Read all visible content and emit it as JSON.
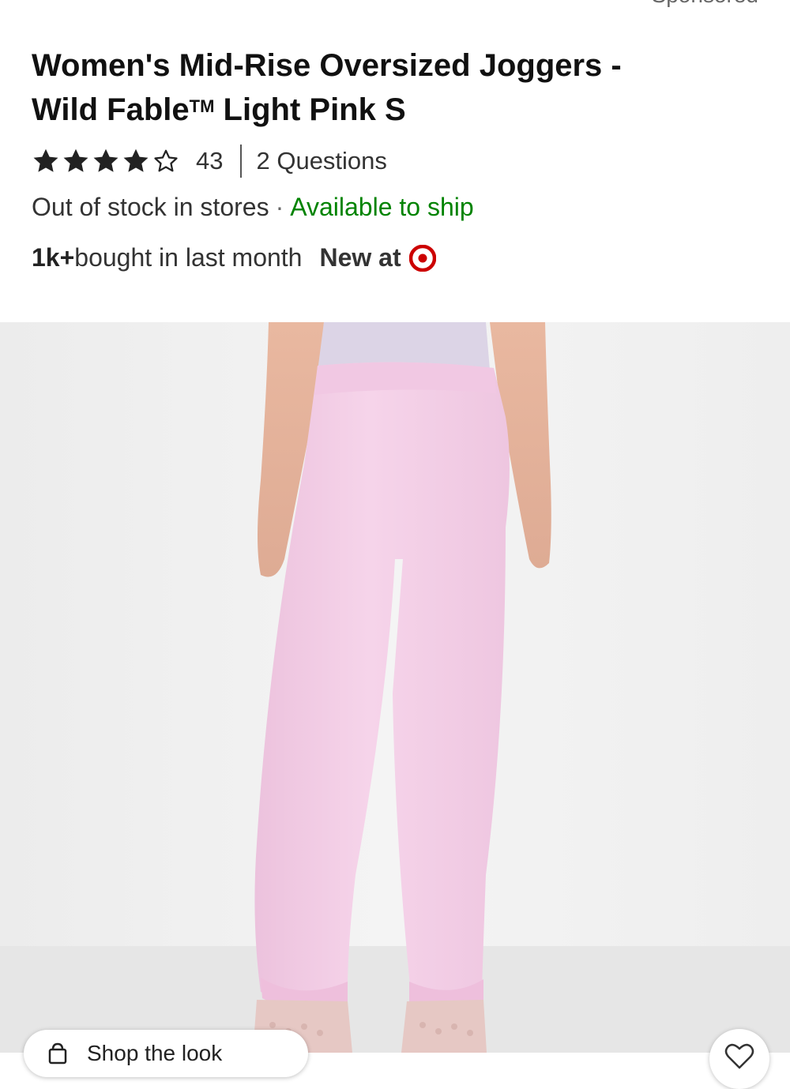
{
  "header": {
    "sponsored_label": "Sponsored"
  },
  "product": {
    "title_line1": "Women's Mid-Rise Oversized Joggers -",
    "title_line2_brand": "Wild Fable",
    "title_tm": "TM",
    "title_line2_variant": " Light Pink S",
    "rating": 4,
    "rating_max": 5,
    "review_count": "43",
    "questions_label": "2 Questions",
    "stock_status": "Out of stock in stores",
    "separator": "·",
    "ship_status": "Available to ship",
    "bought_count": "1k+",
    "bought_text": " bought in last month",
    "new_at_label": "New at"
  },
  "colors": {
    "ship_green": "#008300",
    "target_red": "#cc0000",
    "pants_pink": "#f3cfe6",
    "background": "#f0f0f0"
  },
  "image": {
    "icon": "product-photo-pink-joggers"
  },
  "bottom_bar": {
    "pill_label": "Shop the look",
    "pill_icon": "bag-icon",
    "fav_icon": "heart-icon"
  }
}
